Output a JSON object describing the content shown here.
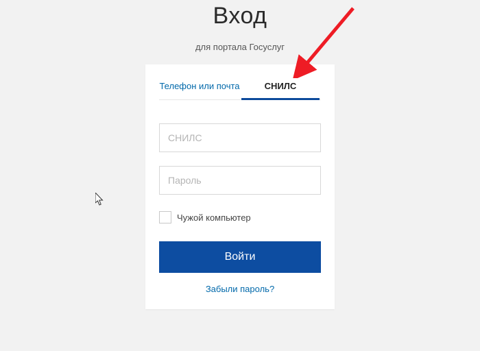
{
  "header": {
    "title": "Вход",
    "subtitle": "для портала Госуслуг"
  },
  "tabs": {
    "phone_email": "Телефон или почта",
    "snils": "СНИЛС"
  },
  "form": {
    "snils_placeholder": "СНИЛС",
    "password_placeholder": "Пароль",
    "foreign_computer_label": "Чужой компьютер",
    "login_button": "Войти",
    "forgot_password": "Забыли пароль?"
  }
}
